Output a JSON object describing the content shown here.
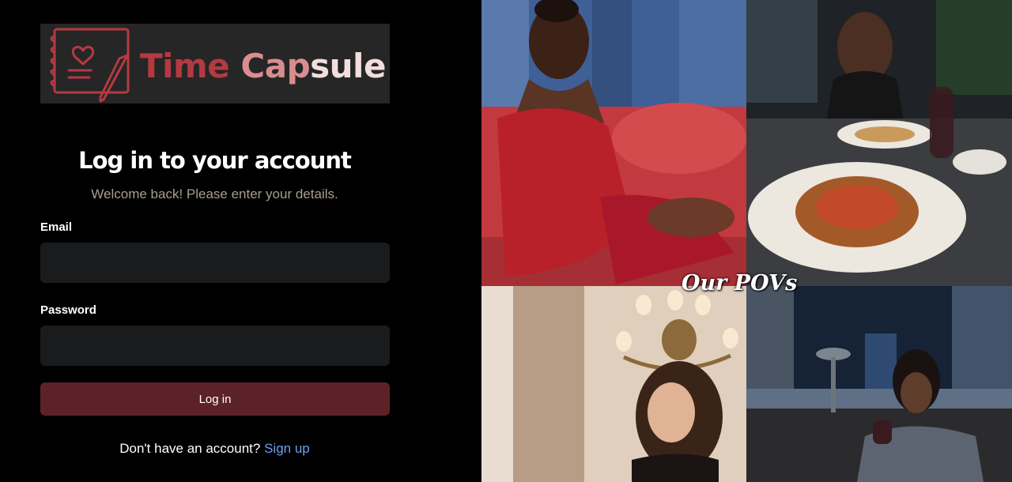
{
  "brand": {
    "logo_text_part1": "Time ",
    "logo_text_part2": "Cap",
    "logo_text_part3": "sule",
    "icon": "journal-heart-icon",
    "colors": {
      "dark": "#b43a42",
      "mid": "#d98d90",
      "light": "#f2dede"
    }
  },
  "login": {
    "title": "Log in to your account",
    "subtitle": "Welcome back! Please enter your details.",
    "email_label": "Email",
    "email_value": "",
    "password_label": "Password",
    "password_value": "",
    "submit_label": "Log in",
    "signup_prompt": "Don't have an account?",
    "signup_link": "Sign up"
  },
  "collage": {
    "caption": "Our POVs",
    "photos": [
      "woman-in-red-dress-photo",
      "dinner-plate-photo",
      "chandelier-portrait-photo",
      "rooftop-drink-photo"
    ]
  },
  "colors": {
    "background": "#000000",
    "input_bg": "#191b1d",
    "button_bg": "#5c2228",
    "link": "#6aa0ea",
    "subtitle": "#a79e92"
  }
}
